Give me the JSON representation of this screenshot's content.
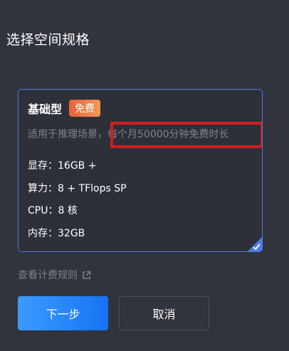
{
  "header": {
    "title": "选择空间规格"
  },
  "plan": {
    "name": "基础型",
    "badge": "免费",
    "description": "适用于推理场景，每个月50000分钟免费时长",
    "specs": [
      {
        "label": "显存：",
        "value": "16GB +"
      },
      {
        "label": "算力：",
        "value": "8 + TFlops SP"
      },
      {
        "label": "CPU：",
        "value": "8 核"
      },
      {
        "label": "内存：",
        "value": "32GB"
      }
    ],
    "selected": true
  },
  "billing_link": {
    "label": "查看计费规则",
    "icon": "external-link-icon"
  },
  "actions": {
    "next_label": "下一步",
    "cancel_label": "取消"
  },
  "colors": {
    "background": "#31343d",
    "accent": "#4f7ae8",
    "primary_button": "#1873f5",
    "badge": "#ec7a45",
    "highlight_box": "#d41d1d"
  }
}
